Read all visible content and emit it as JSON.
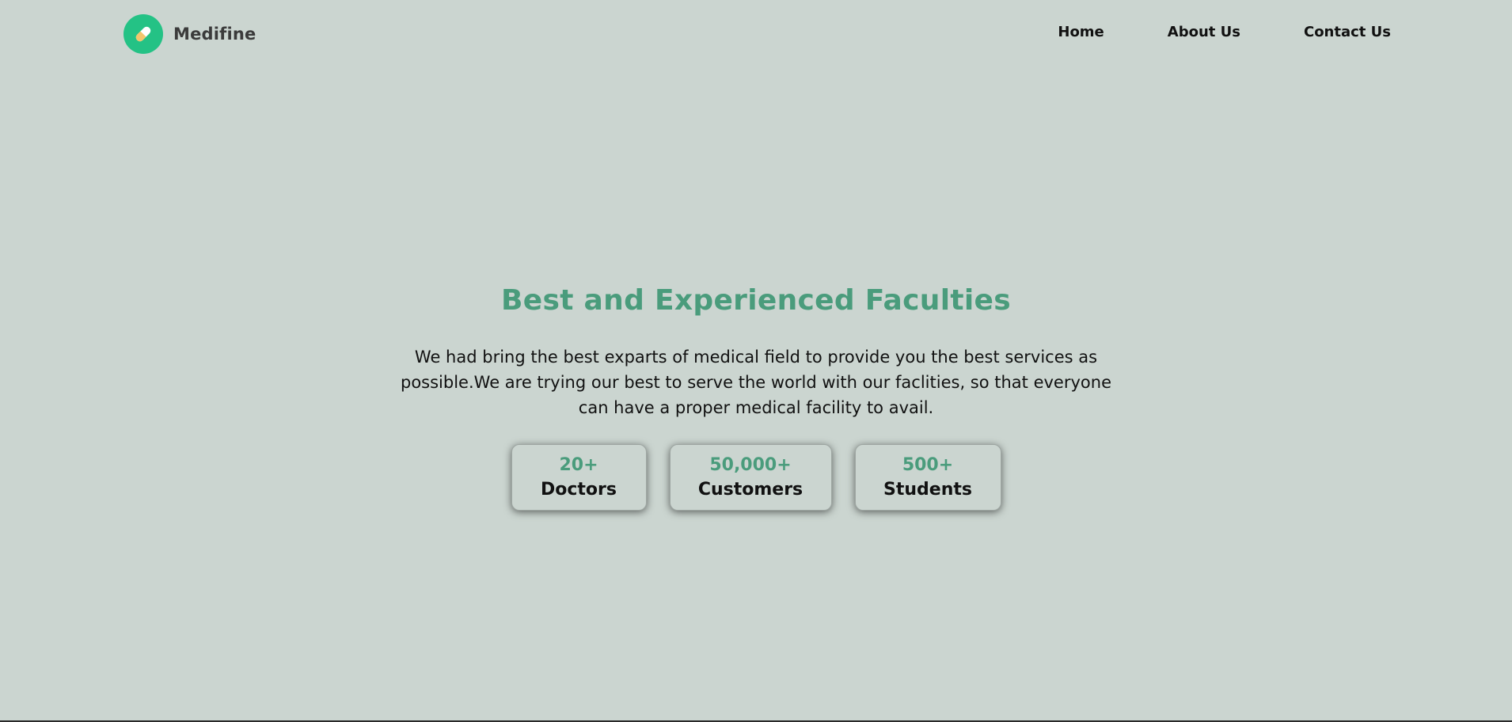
{
  "brand": {
    "name": "Medifine",
    "logo_icon": "pill-icon",
    "logo_color": "#24c285"
  },
  "nav": {
    "items": [
      {
        "label": "Home"
      },
      {
        "label": "About Us"
      },
      {
        "label": "Contact Us"
      }
    ]
  },
  "hero": {
    "title": "Best and Experienced Faculties",
    "description": "We had bring the best exparts of medical field to provide you the best services as possible.We are trying our best to serve the world with our faclities, so that everyone can have a proper medical facility to avail."
  },
  "stats": [
    {
      "value": "20+",
      "label": "Doctors"
    },
    {
      "value": "50,000+",
      "label": "Customers"
    },
    {
      "value": "500+",
      "label": "Students"
    }
  ],
  "colors": {
    "background": "#cbd5d0",
    "accent": "#4a9c7c",
    "text": "#111111"
  }
}
